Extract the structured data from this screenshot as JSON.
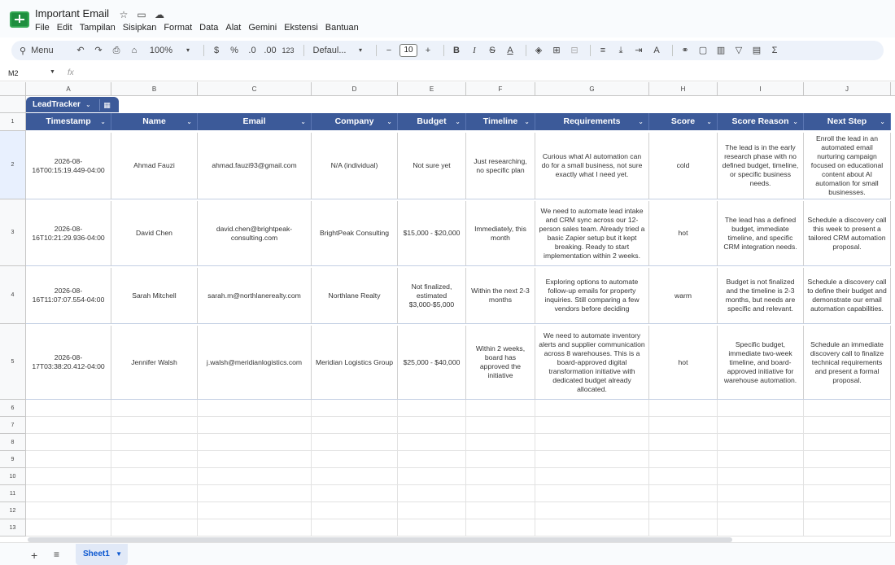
{
  "app": {
    "title": "Important Email",
    "menus": [
      "File",
      "Edit",
      "Tampilan",
      "Sisipkan",
      "Format",
      "Data",
      "Alat",
      "Gemini",
      "Ekstensi",
      "Bantuan"
    ]
  },
  "toolbar": {
    "search_label": "Menu",
    "zoom": "100%",
    "currency": "$",
    "percent": "%",
    "dec_less": ".0",
    "dec_more": ".00",
    "num_format": "123",
    "font": "Defaul...",
    "font_size": "10"
  },
  "formula": {
    "cell_ref": "M2",
    "fx": "fx"
  },
  "columns": [
    "A",
    "B",
    "C",
    "D",
    "E",
    "F",
    "G",
    "H",
    "I",
    "J"
  ],
  "table": {
    "name": "LeadTracker",
    "headers": [
      "Timestamp",
      "Name",
      "Email",
      "Company",
      "Budget",
      "Timeline",
      "Requirements",
      "Score",
      "Score Reason",
      "Next Step"
    ],
    "rows": [
      [
        "2026-08-16T00:15:19.449-04:00",
        "Ahmad Fauzi",
        "ahmad.fauzi93@gmail.com",
        "N/A (individual)",
        "Not sure yet",
        "Just researching, no specific plan",
        "Curious what AI automation can do for a small business, not sure exactly what I need yet.",
        "cold",
        "The lead is in the early research phase with no defined budget, timeline, or specific business needs.",
        "Enroll the lead in an automated email nurturing campaign focused on educational content about AI automation for small businesses."
      ],
      [
        "2026-08-16T10:21:29.936-04:00",
        "David Chen",
        "david.chen@brightpeak-consulting.com",
        "BrightPeak Consulting",
        "$15,000 - $20,000",
        "Immediately, this month",
        "We need to automate lead intake and CRM sync across our 12-person sales team. Already tried a basic Zapier setup but it kept breaking. Ready to start implementation within 2 weeks.",
        "hot",
        "The lead has a defined budget, immediate timeline, and specific CRM integration needs.",
        "Schedule a discovery call this week to present a tailored CRM automation proposal."
      ],
      [
        "2026-08-16T11:07:07.554-04:00",
        "Sarah Mitchell",
        "sarah.m@northlanerealty.com",
        "Northlane Realty",
        "Not finalized, estimated $3,000-$5,000",
        "Within the next 2-3 months",
        "Exploring options to automate follow-up emails for property inquiries. Still comparing a few vendors before deciding",
        "warm",
        "Budget is not finalized and the timeline is 2-3 months, but needs are specific and relevant.",
        "Schedule a discovery call to define their budget and demonstrate our email automation capabilities."
      ],
      [
        "2026-08-17T03:38:20.412-04:00",
        "Jennifer Walsh",
        "j.walsh@meridianlogistics.com",
        "Meridian Logistics Group",
        "$25,000 - $40,000",
        "Within 2 weeks, board has approved the initiative",
        "We need to automate inventory alerts and supplier communication across 8 warehouses. This is a board-approved digital transformation initiative with dedicated budget already allocated.",
        "hot",
        "Specific budget, immediate two-week timeline, and board-approved initiative for warehouse automation.",
        "Schedule an immediate discovery call to finalize technical requirements and present a formal proposal."
      ]
    ]
  },
  "row_numbers": [
    "1",
    "2",
    "3",
    "4",
    "5",
    "6",
    "7",
    "8",
    "9",
    "10",
    "11",
    "12",
    "13"
  ],
  "sheet": {
    "tab": "Sheet1"
  }
}
